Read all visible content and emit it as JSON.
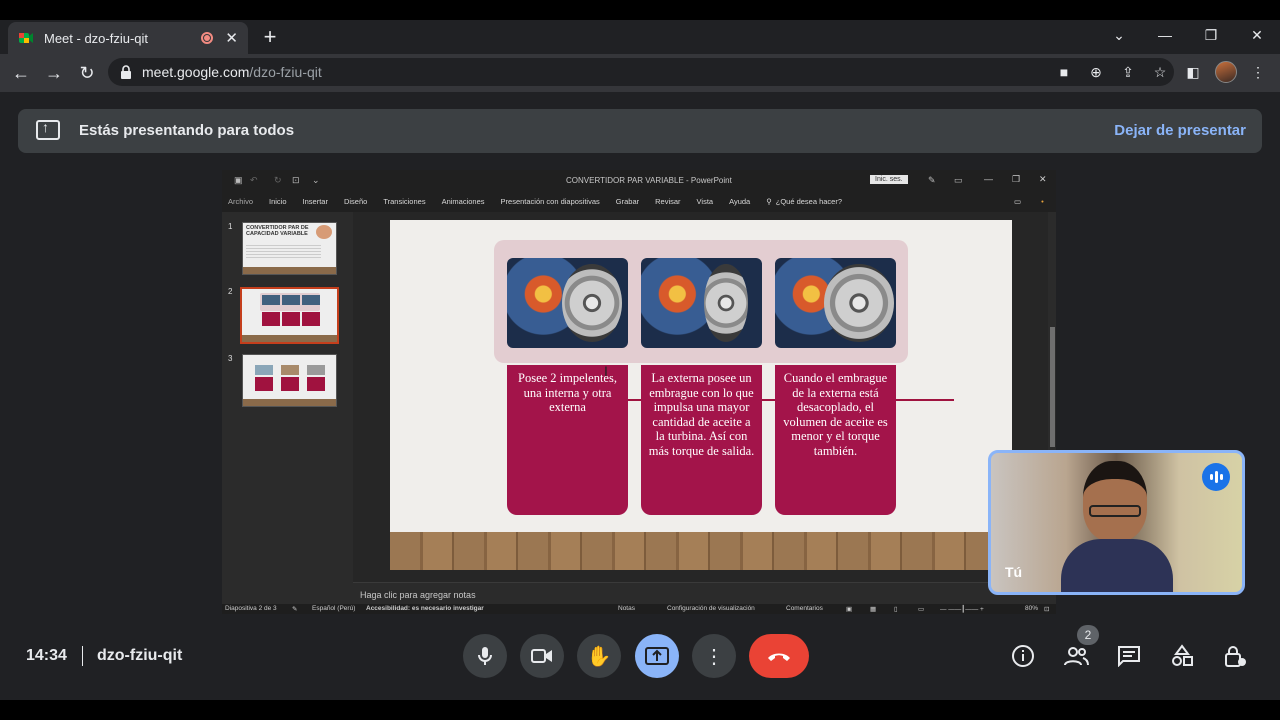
{
  "browser": {
    "tab_title": "Meet - dzo-fziu-qit",
    "tab_close": "✕",
    "new_tab": "+",
    "url_host": "meet.google.com",
    "url_path": "/dzo-fziu-qit",
    "window_controls": [
      "⌄",
      "—",
      "❐",
      "✕"
    ]
  },
  "banner": {
    "message": "Estás presentando para todos",
    "stop_button": "Dejar de presentar"
  },
  "powerpoint": {
    "window_title": "CONVERTIDOR PAR VARIABLE  -  PowerPoint",
    "signin": "Inic. ses.",
    "menu": [
      "Archivo",
      "Inicio",
      "Insertar",
      "Diseño",
      "Transiciones",
      "Animaciones",
      "Presentación con diapositivas",
      "Grabar",
      "Revisar",
      "Vista",
      "Ayuda",
      "¿Qué desea hacer?"
    ],
    "thumbnails": [
      {
        "number": "1",
        "title_line1": "CONVERTIDOR PAR DE",
        "title_line2": "CAPACIDAD VARIABLE"
      },
      {
        "number": "2"
      },
      {
        "number": "3"
      }
    ],
    "slide_cards": [
      "Posee 2 impelentes, una interna y otra externa",
      "La externa posee un embrague con lo que impulsa una mayor cantidad de aceite a la turbina. Así con más torque de salida.",
      "Cuando el embrague de la externa está desacoplado, el volumen de aceite es menor y el torque también."
    ],
    "notes_placeholder": "Haga clic para agregar notas",
    "status": {
      "slide_count": "Diapositiva 2 de 3",
      "language": "Español (Perú)",
      "accessibility": "Accesibilidad: es necesario investigar",
      "notes": "Notas",
      "display_settings": "Configuración de visualización",
      "comments": "Comentarios",
      "zoom": "80%"
    }
  },
  "self_view": {
    "label": "Tú"
  },
  "meeting": {
    "time": "14:34",
    "code": "dzo-fziu-qit",
    "participants_count": "2"
  },
  "colors": {
    "accent": "#8ab4f8",
    "end_call": "#ea4335",
    "slide_card": "#a3144a"
  }
}
